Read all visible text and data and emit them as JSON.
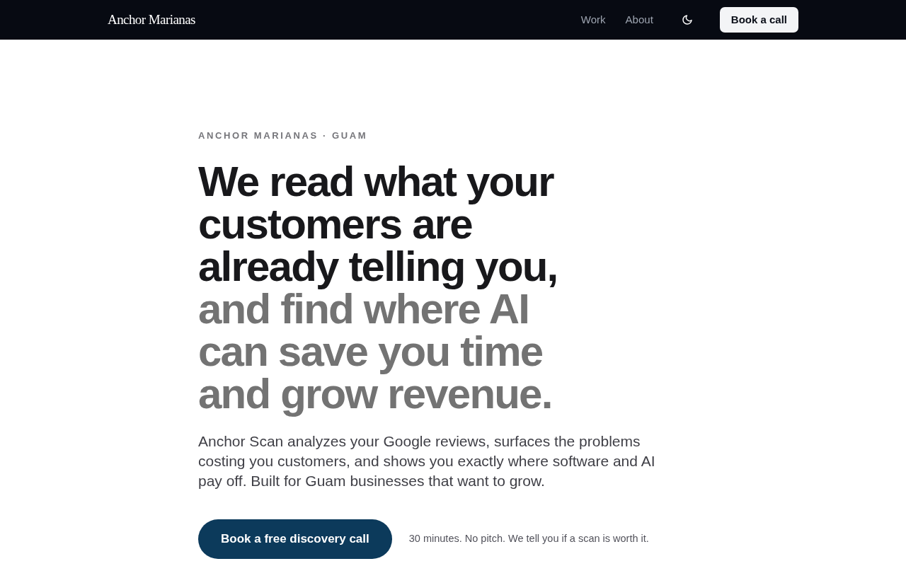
{
  "nav": {
    "logo": "Anchor Marianas",
    "links": [
      {
        "label": "Work"
      },
      {
        "label": "About"
      }
    ],
    "cta": "Book a call"
  },
  "hero": {
    "eyebrow": "ANCHOR MARIANAS · GUAM",
    "heading": {
      "lead": "We read what your customers are already telling you,",
      "rest": "and find where AI can save you time and grow revenue."
    },
    "body": "Anchor Scan analyzes your Google reviews, surfaces the problems costing you customers, and shows you exactly where software and AI pay off. Built for Guam businesses that want to grow.",
    "cta": "Book a free discovery call",
    "note": "30 minutes. No pitch. We tell you if a scan is worth it."
  }
}
